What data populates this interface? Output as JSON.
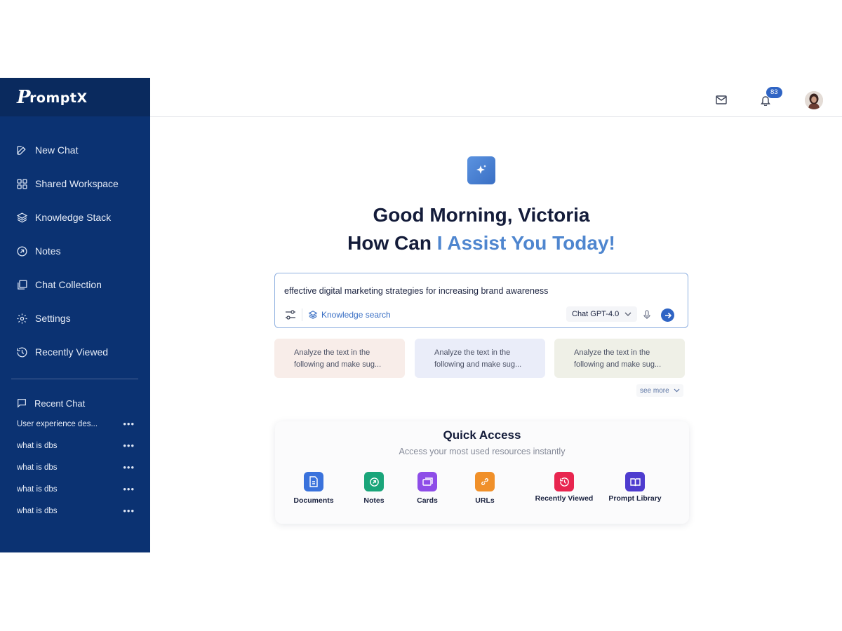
{
  "app": {
    "brand": "PromptX"
  },
  "sidebar": {
    "nav": [
      {
        "label": "New Chat",
        "icon": "edit-icon"
      },
      {
        "label": "Shared Workspace",
        "icon": "workspace-grid-icon"
      },
      {
        "label": "Knowledge Stack",
        "icon": "layers-icon"
      },
      {
        "label": "Notes",
        "icon": "note-icon"
      },
      {
        "label": "Chat Collection",
        "icon": "collection-icon"
      },
      {
        "label": "Settings",
        "icon": "gear-icon"
      },
      {
        "label": "Recently Viewed",
        "icon": "history-icon"
      }
    ],
    "recent_heading": "Recent Chat",
    "recent": [
      {
        "title": "User experience des..."
      },
      {
        "title": "what is dbs"
      },
      {
        "title": "what is dbs"
      },
      {
        "title": "what is dbs"
      },
      {
        "title": "what is dbs"
      }
    ],
    "more_glyph": "•••"
  },
  "topbar": {
    "notification_count": "83"
  },
  "main": {
    "greeting_line1": "Good Morning, Victoria",
    "greeting_line2_plain": "How Can ",
    "greeting_line2_accent": "I Assist You Today!",
    "prompt": {
      "value": "effective digital marketing strategies for increasing brand awareness",
      "knowledge_search": "Knowledge search",
      "model": "Chat GPT-4.0"
    },
    "suggestions": [
      {
        "line1": "Analyze the text in the",
        "line2": "following and make sug..."
      },
      {
        "line1": "Analyze the text in the",
        "line2": "following and make sug..."
      },
      {
        "line1": "Analyze the text in the",
        "line2": "following and make sug..."
      }
    ],
    "see_more": "see more",
    "quick_access": {
      "title": "Quick Access",
      "subtitle": "Access your most used resources instantly",
      "items": [
        {
          "label": "Documents",
          "color": "#3a72dc"
        },
        {
          "label": "Notes",
          "color": "#1aa57a"
        },
        {
          "label": "Cards",
          "color": "#8e4de8"
        },
        {
          "label": "URLs",
          "color": "#f0902a"
        },
        {
          "label": "Recently Viewed",
          "color": "#e8254f"
        },
        {
          "label": "Prompt Library",
          "color": "#4e3ccf"
        }
      ]
    }
  }
}
